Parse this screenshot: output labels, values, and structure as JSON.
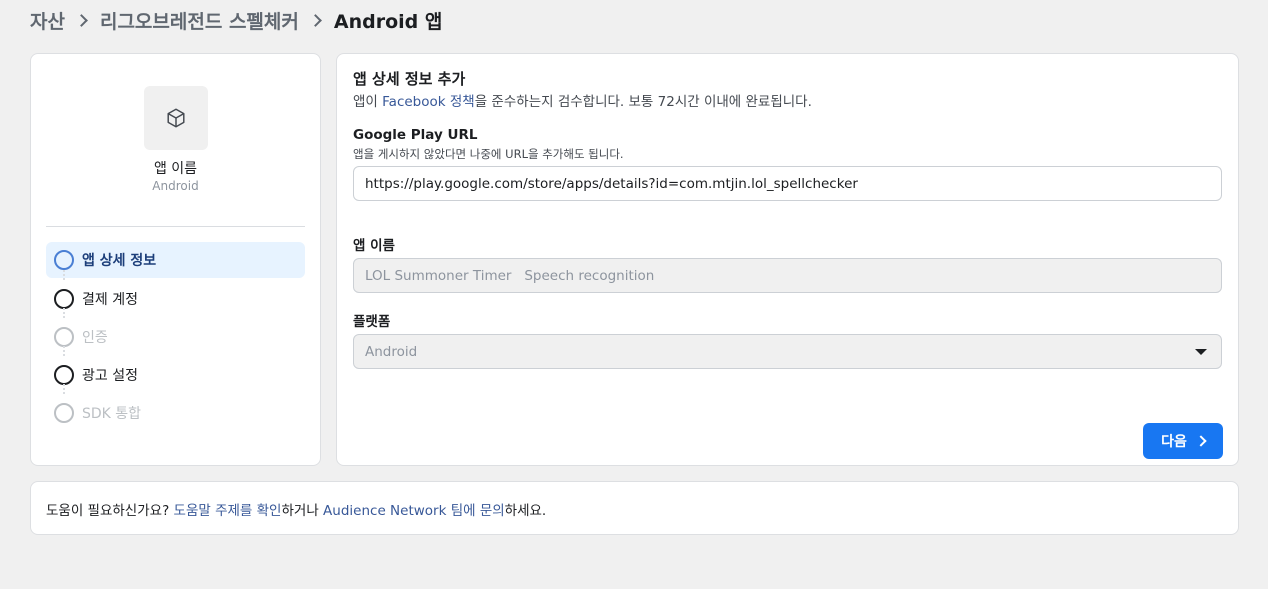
{
  "breadcrumb": {
    "items": [
      "자산",
      "리그오브레전드 스펠체커",
      "Android 앱"
    ]
  },
  "sidebar": {
    "app_name": "앱 이름",
    "app_platform": "Android",
    "steps": [
      {
        "label": "앱 상세 정보",
        "state": "active"
      },
      {
        "label": "결제 계정",
        "state": "enabled"
      },
      {
        "label": "인증",
        "state": "disabled"
      },
      {
        "label": "광고 설정",
        "state": "enabled"
      },
      {
        "label": "SDK 통합",
        "state": "disabled"
      }
    ]
  },
  "main": {
    "title": "앱 상세 정보 추가",
    "desc_prefix": "앱이 ",
    "desc_link": "Facebook 정책",
    "desc_suffix": "을 준수하는지 검수합니다. 보통 72시간 이내에 완료됩니다.",
    "play_url_label": "Google Play URL",
    "play_url_hint": "앱을 게시하지 않았다면 나중에 URL을 추가해도 됩니다.",
    "play_url_value": "https://play.google.com/store/apps/details?id=com.mtjin.lol_spellchecker",
    "app_name_label": "앱 이름",
    "app_name_value": "LOL Summoner Timer   Speech recognition",
    "platform_label": "플랫폼",
    "platform_value": "Android",
    "next_label": "다음"
  },
  "help": {
    "prefix": "도움이 필요하신가요? ",
    "link1": "도움말 주제를 확인",
    "middle": "하거나 ",
    "link2": "Audience Network 팀에 문의",
    "suffix": "하세요."
  },
  "colors": {
    "accent": "#1877f2",
    "link": "#385898",
    "active_step_bg": "#e7f3ff"
  }
}
